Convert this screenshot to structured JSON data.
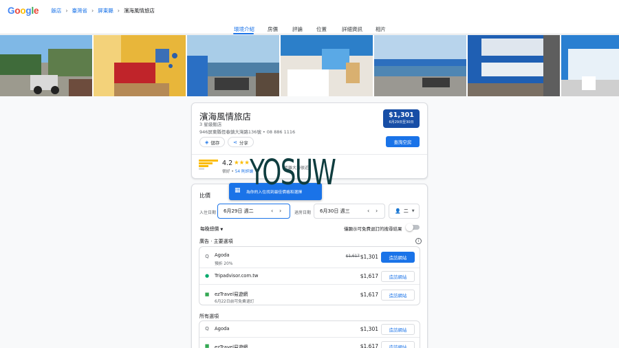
{
  "logo": {
    "text": "Google",
    "colors": [
      "#4285f4",
      "#ea4335",
      "#fbbc05",
      "#4285f4",
      "#34a853",
      "#ea4335"
    ]
  },
  "breadcrumb": [
    "飯店",
    "臺灣省",
    "屏東縣",
    "濱海風情旅店"
  ],
  "tabs": [
    "環境介紹",
    "房價",
    "評論",
    "位置",
    "詳細資訊",
    "相片"
  ],
  "hotel": {
    "name": "濱海風情旅店",
    "class": "3 星級飯店",
    "address": "946屏東縣恆春鎮大灣路136號 • 08 886 1116",
    "save": "儲存",
    "share": "分享",
    "price": "$1,301",
    "dates": "6月29日至30日",
    "view_button": "查詢空房",
    "rating": "4.2",
    "stars": "★★★",
    "reviews_label": "很好 •",
    "reviews_count": "54 則評論",
    "highlight_text": "距離大海很近"
  },
  "watermark": "YOSUW",
  "tooltip": "為你的入住找到最佳價格和選擇",
  "prices": {
    "title": "比價",
    "checkin_label": "入住日期",
    "checkin_value": "6月29日 週二",
    "checkout_label": "退房日期",
    "checkout_value": "6月30日 週三",
    "guests": "二",
    "per_night": "每晚總價",
    "free_cancel_label": "僅顯示可免費退訂的搜尋結果",
    "ads_label": "廣告 · 主要選項",
    "all_label": "所有選項",
    "ads": [
      {
        "name": "Agoda",
        "sub": "預折 20%",
        "old": "$1,617",
        "price": "$1,301",
        "button": "造訪網站",
        "primary": true,
        "icon": "Q",
        "iconColor": "#5f6368"
      },
      {
        "name": "Tripadvisor.com.tw",
        "sub": "",
        "old": "",
        "price": "$1,617",
        "button": "造訪網站",
        "primary": false,
        "icon": "●",
        "iconColor": "#00aa6c"
      },
      {
        "name": "ezTravel易遊網",
        "sub": "6月22日前可免費退訂",
        "old": "",
        "price": "$1,617",
        "button": "造訪網站",
        "primary": false,
        "icon": "■",
        "iconColor": "#34a853"
      }
    ],
    "all": [
      {
        "name": "Agoda",
        "sub": "",
        "price": "$1,301",
        "button": "造訪網站",
        "icon": "Q",
        "iconColor": "#5f6368"
      },
      {
        "name": "ezTravel易遊網",
        "sub": "",
        "price": "$1,617",
        "button": "造訪網站",
        "icon": "■",
        "iconColor": "#34a853"
      }
    ]
  }
}
